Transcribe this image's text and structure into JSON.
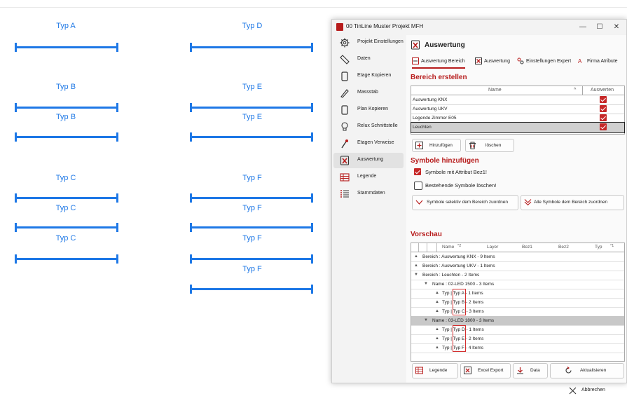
{
  "cad": {
    "labels": [
      "Typ A",
      "Typ D",
      "Typ B",
      "Typ E",
      "Typ B",
      "Typ E",
      "Typ C",
      "Typ F",
      "Typ C",
      "Typ F",
      "Typ C",
      "Typ F",
      "Typ F"
    ]
  },
  "window": {
    "title": "00 TinLine Muster Projekt MFH",
    "minimize": "—",
    "maximize": "☐",
    "close": "✕"
  },
  "sidebar": {
    "items": [
      {
        "label": "Projekt Einstellungen",
        "icon": "gear-icon"
      },
      {
        "label": "Daten",
        "icon": "ruler-icon"
      },
      {
        "label": "Etage Kopieren",
        "icon": "copy-icon"
      },
      {
        "label": "Massstab",
        "icon": "scale-icon"
      },
      {
        "label": "Plan Kopieren",
        "icon": "copy-icon"
      },
      {
        "label": "Relux Schnittstelle",
        "icon": "bulb-icon"
      },
      {
        "label": "Etagen Verweise",
        "icon": "pin-icon"
      },
      {
        "label": "Auswertung",
        "icon": "excel-icon"
      },
      {
        "label": "Legende",
        "icon": "table-icon"
      },
      {
        "label": "Stammdaten",
        "icon": "list-icon"
      }
    ]
  },
  "main": {
    "title": "Auswertung",
    "tabs": [
      "Auswertung Bereich",
      "Auswertung",
      "Einstellungen Expert",
      "Firma Atribute"
    ],
    "bereich_title": "Bereich erstellen",
    "grid1": {
      "col_name": "Name",
      "col_sort": "^",
      "col_auswerten": "Auswerten",
      "rows": [
        "Auswertung KNX",
        "Auswertung UKV",
        "Legende Zimmer E05",
        "Leuchten"
      ]
    },
    "btn_add": "Hinzufügen",
    "btn_delete": "löschen",
    "symbole_title": "Symbole hinzufügen",
    "cb_attribut": "Symbole mit Attribut Bez1!",
    "cb_delete": "Bestehende Symbole löschen!",
    "btn_selektiv": "Symbole selektiv dem Bereich zuordnen",
    "btn_alle": "Alle Symbole dem Bereich zuordnen",
    "vorschau_title": "Vorschau",
    "grid2": {
      "headers": [
        "Name",
        "^2",
        "Layer",
        "Bez1",
        "Bez2",
        "Typ",
        "^1"
      ],
      "rows": [
        "Bereich : Auswertung KNX - 9 Items",
        "Bereich : Auswertung UKV - 1 Items",
        "Bereich : Leuchten - 2 Items",
        "Name : 02-LED 1500 - 3 Items",
        "Typ | Typ A - 1 Items",
        "Typ | Typ B - 2 Items",
        "Typ | Typ C - 3 Items",
        "Name : 03-LED 1800 - 3 Items",
        "Typ | Typ D - 1 Items",
        "Typ | Typ E - 2 Items",
        "Typ | Typ F - 4 Items"
      ]
    },
    "footer": {
      "legende": "Legende",
      "excel": "Excel Export",
      "data": "Data",
      "refresh": "Aktualisieren",
      "abbrechen": "Abbrechen"
    }
  },
  "colors": {
    "accent": "#b71c1c",
    "cad_blue": "#1e78e6"
  }
}
